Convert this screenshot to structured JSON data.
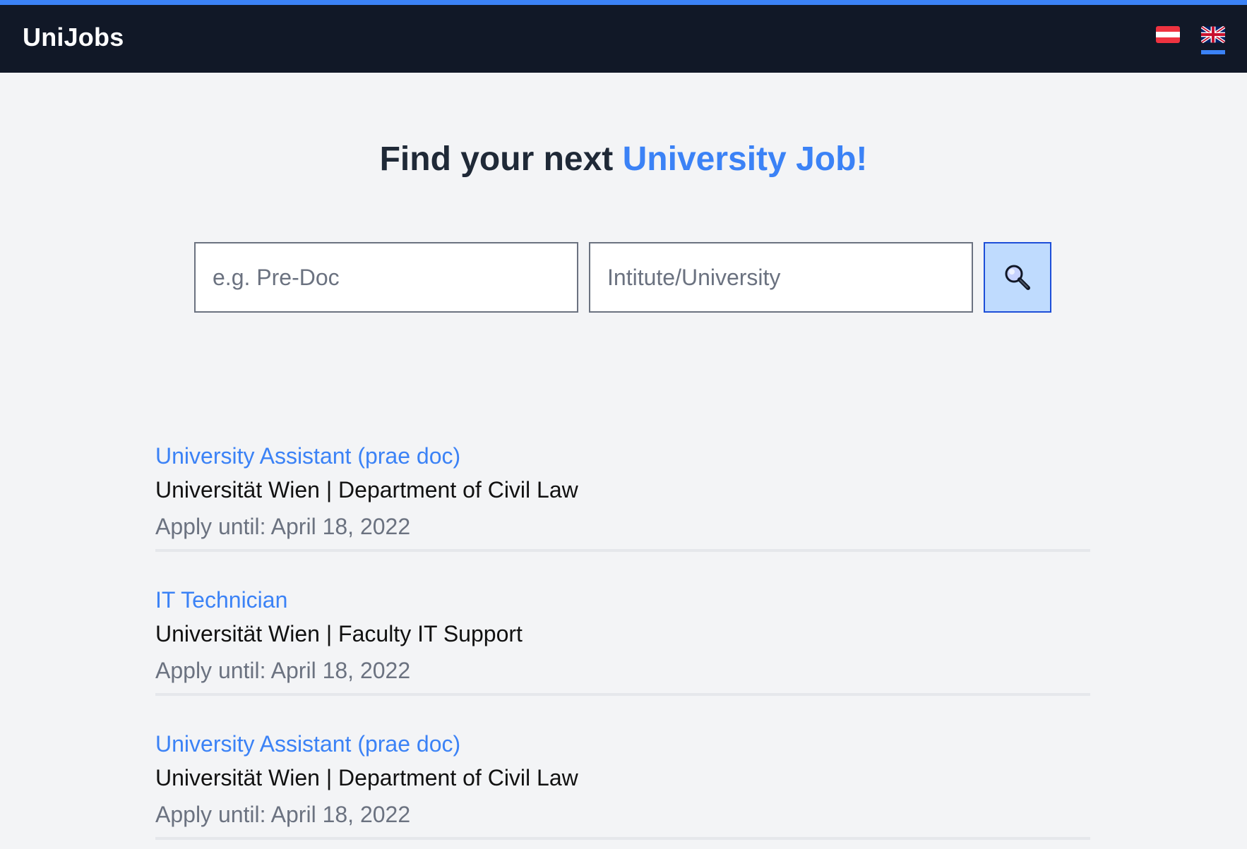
{
  "header": {
    "brand": "UniJobs",
    "accent_color": "#3b82f6",
    "background_color": "#111827",
    "languages": [
      {
        "code": "de-AT",
        "icon": "austria-flag-icon",
        "active": false
      },
      {
        "code": "en-GB",
        "icon": "uk-flag-icon",
        "active": true
      }
    ]
  },
  "hero": {
    "title_prefix": "Find your next",
    "title_highlight": "University Job!"
  },
  "search": {
    "job_placeholder": "e.g. Pre-Doc",
    "job_value": "",
    "institute_placeholder": "Intitute/University",
    "institute_value": "",
    "button_icon": "magnifier-icon"
  },
  "jobs": [
    {
      "title": "University Assistant (prae doc)",
      "organization": "Universität Wien | Department of Civil Law",
      "deadline": "Apply until: April 18, 2022"
    },
    {
      "title": "IT Technician",
      "organization": "Universität Wien | Faculty IT Support",
      "deadline": "Apply until: April 18, 2022"
    },
    {
      "title": "University Assistant (prae doc)",
      "organization": "Universität Wien | Department of Civil Law",
      "deadline": "Apply until: April 18, 2022"
    }
  ]
}
